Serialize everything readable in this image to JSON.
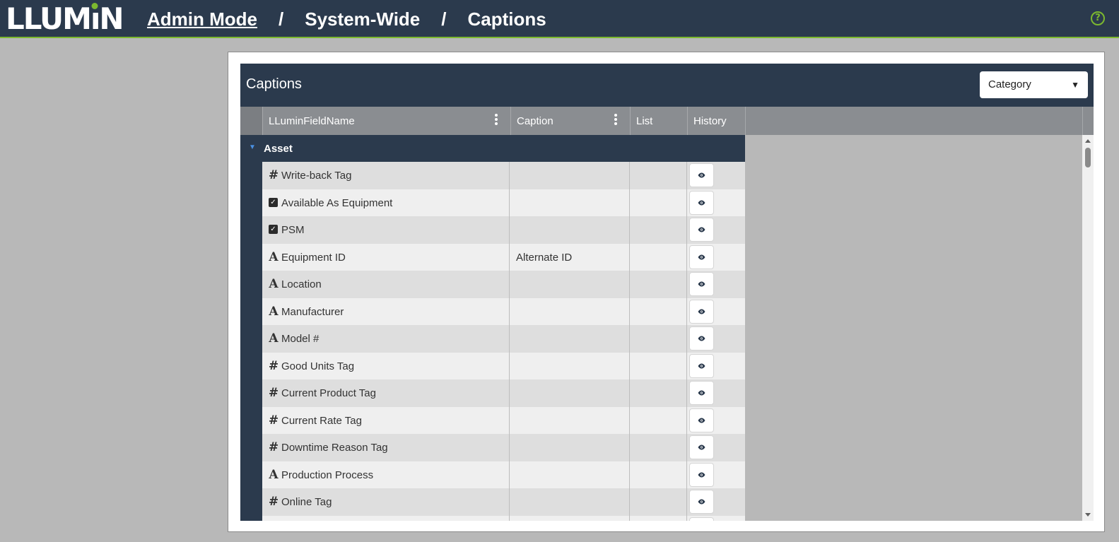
{
  "app": {
    "logo_text": "LLUMIN"
  },
  "breadcrumb": {
    "admin": "Admin Mode",
    "sep": "/",
    "system": "System-Wide",
    "page": "Captions"
  },
  "grid": {
    "title": "Captions",
    "category_select": {
      "value": "Category"
    },
    "columns": {
      "field": "LLuminFieldName",
      "caption": "Caption",
      "list": "List",
      "history": "History"
    },
    "group": "Asset",
    "rows": [
      {
        "type": "number-icon",
        "name": "Write-back Tag",
        "caption": ""
      },
      {
        "type": "checkbox-icon",
        "name": "Available As Equipment",
        "caption": ""
      },
      {
        "type": "checkbox-icon",
        "name": "PSM",
        "caption": ""
      },
      {
        "type": "text-icon",
        "name": "Equipment ID",
        "caption": "Alternate ID"
      },
      {
        "type": "text-icon",
        "name": "Location",
        "caption": ""
      },
      {
        "type": "text-icon",
        "name": "Manufacturer",
        "caption": ""
      },
      {
        "type": "text-icon",
        "name": "Model #",
        "caption": ""
      },
      {
        "type": "number-icon",
        "name": "Good Units Tag",
        "caption": ""
      },
      {
        "type": "number-icon",
        "name": "Current Product Tag",
        "caption": ""
      },
      {
        "type": "number-icon",
        "name": "Current Rate Tag",
        "caption": ""
      },
      {
        "type": "number-icon",
        "name": "Downtime Reason Tag",
        "caption": ""
      },
      {
        "type": "text-icon",
        "name": "Production Process",
        "caption": ""
      },
      {
        "type": "number-icon",
        "name": "Online Tag",
        "caption": ""
      },
      {
        "type": "number-icon",
        "name": "",
        "caption": ""
      }
    ]
  },
  "colors": {
    "header_bg": "#2b3a4d",
    "accent_green": "#7cb82f",
    "group_triangle": "#4a90e2"
  }
}
